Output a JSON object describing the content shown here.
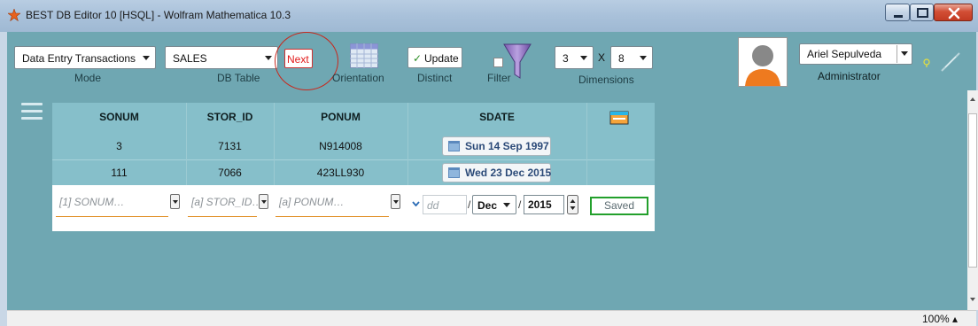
{
  "window": {
    "title": "BEST DB Editor 10 [HSQL] - Wolfram Mathematica 10.3"
  },
  "toolbar": {
    "mode": {
      "value": "Data Entry Transactions",
      "label": "Mode"
    },
    "db_table": {
      "value": "SALES",
      "label": "DB Table"
    },
    "next_label": "Next",
    "orientation_label": "Orientation",
    "update_label": "Update",
    "distinct_label": "Distinct",
    "filter_label": "Filter",
    "dimensions": {
      "rows": "3",
      "x": "X",
      "cols": "8",
      "label": "Dimensions"
    },
    "user": {
      "name": "Ariel Sepulveda",
      "role": "Administrator"
    }
  },
  "grid": {
    "columns": [
      "SONUM",
      "STOR_ID",
      "PONUM",
      "SDATE"
    ],
    "rows": [
      {
        "sonum": "3",
        "stor_id": "7131",
        "ponum": "N914008",
        "sdate": "Sun 14 Sep 1997"
      },
      {
        "sonum": "111",
        "stor_id": "7066",
        "ponum": "423LL930",
        "sdate": "Wed 23 Dec 2015"
      }
    ],
    "entry": {
      "sonum_placeholder": "[1] SONUM…",
      "stor_id_placeholder": "[a] STOR_ID…",
      "ponum_placeholder": "[a] PONUM…",
      "day_placeholder": "dd",
      "month": "Dec",
      "year": "2015",
      "sep": "/",
      "saved_label": "Saved"
    }
  },
  "status": {
    "zoom": "100%"
  },
  "colors": {
    "accent": "#6fa7b2",
    "grid": "#86bfca",
    "saved_border": "#23a02c",
    "next_red": "#e21919"
  }
}
